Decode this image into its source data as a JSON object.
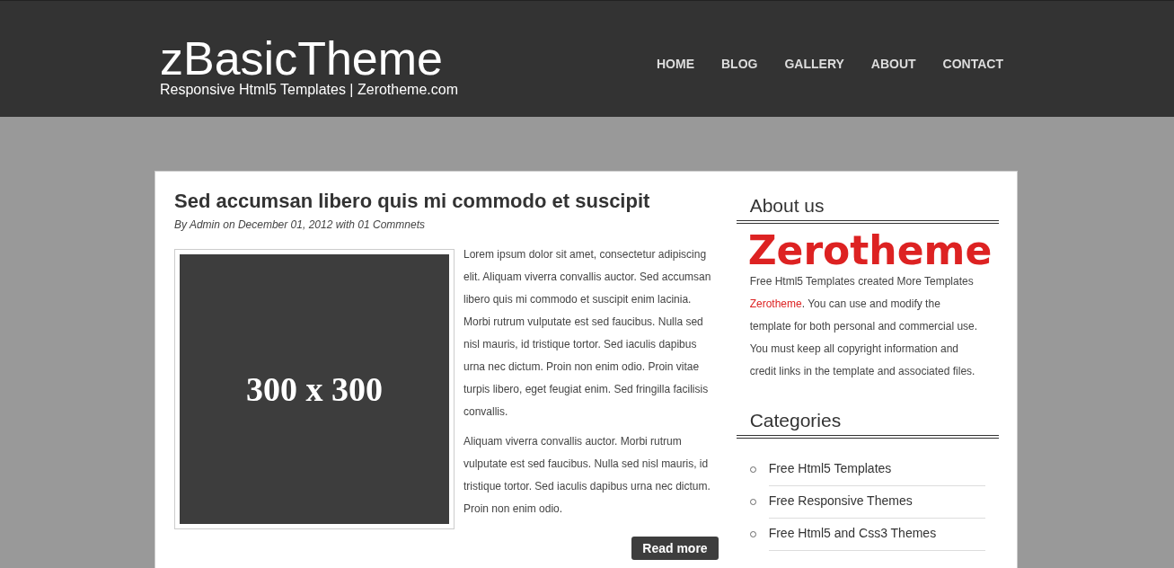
{
  "header": {
    "site_title": "zBasicTheme",
    "tagline": "Responsive Html5 Templates | Zerotheme.com",
    "nav": [
      {
        "label": "HOME"
      },
      {
        "label": "BLOG"
      },
      {
        "label": "GALLERY"
      },
      {
        "label": "ABOUT"
      },
      {
        "label": "CONTACT"
      }
    ]
  },
  "post": {
    "title": "Sed accumsan libero quis mi commodo et suscipit",
    "meta": "By Admin on December 01, 2012 with 01 Commnets",
    "image_placeholder": "300 x 300",
    "paragraphs": [
      "Lorem ipsum dolor sit amet, consectetur adipiscing elit. Aliquam viverra convallis auctor. Sed accumsan libero quis mi commodo et suscipit enim lacinia. Morbi rutrum vulputate est sed faucibus. Nulla sed nisl mauris, id tristique tortor. Sed iaculis dapibus urna nec dictum. Proin non enim odio. Proin vitae turpis libero, eget feugiat enim. Sed fringilla facilisis convallis.",
      "Aliquam viverra convallis auctor. Morbi rutrum vulputate est sed faucibus. Nulla sed nisl mauris, id tristique tortor. Sed iaculis dapibus urna nec dictum. Proin non enim odio."
    ],
    "read_more": "Read more"
  },
  "sidebar": {
    "about": {
      "heading": "About us",
      "logo_text": "Zerotheme",
      "text_before": "Free Html5 Templates created More Templates ",
      "link": "Zerotheme",
      "text_after": ". You can use and modify the template for both personal and commercial use. You must keep all copyright information and credit links in the template and associated files."
    },
    "categories": {
      "heading": "Categories",
      "items": [
        {
          "label": "Free Html5 Templates"
        },
        {
          "label": "Free Responsive Themes"
        },
        {
          "label": "Free Html5 and Css3 Themes"
        }
      ]
    }
  }
}
